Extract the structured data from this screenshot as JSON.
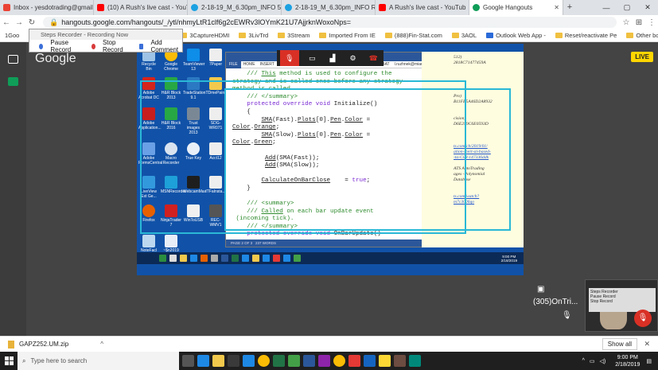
{
  "browser": {
    "tabs": [
      {
        "label": "Inbox - yesdotrading@gmail.",
        "color": "#ea4335"
      },
      {
        "label": "(10) A Rush's live cast - YouT",
        "color": "#ff0000"
      },
      {
        "label": "2-18-19_M_6.30pm_INFO 5%",
        "color": "#1ba1e2"
      },
      {
        "label": "2-18-19_M_6.30pm_INFO Re",
        "color": "#1ba1e2"
      },
      {
        "label": "A Rush's live cast - YouTub",
        "color": "#ff0000"
      },
      {
        "label": "Google Hangouts",
        "color": "#0f9d58"
      }
    ],
    "new_tab": "+",
    "url": "hangouts.google.com/hangouts/_/ytl/nhmyLtR1clf6g2cEWRv3lOYmK21U7AjjrknWoxoNps=",
    "bookmarks": [
      "1Goo",
      "Apps",
      "Google",
      "3CaptureHDMI",
      "3LivTrd",
      "3Stream",
      "Imported From IE",
      "(888)Fin-Stat.com",
      "3AOL",
      "Outlook Web App -",
      "Reset/reactivate Pe",
      "Other bookmarks"
    ]
  },
  "steps_recorder": {
    "title": "Steps Recorder - Recording Now",
    "pause": "Pause Record",
    "stop": "Stop Record",
    "add_comment": "Add Comment"
  },
  "hangouts": {
    "logo": "Google",
    "live_badge": "LIVE",
    "pip_label": "(305)OnTri...",
    "pip_tools": [
      "Steps Recorder",
      "Pause Record",
      "Stop Record"
    ]
  },
  "desktop_icons": [
    "Recycle Bin",
    "Google Chrome",
    "TeamViewer 13",
    "7Paper",
    "Adobe Acrobat DC",
    "H&R Block 2013",
    "TradeStation 9.1",
    "TDmePaint",
    "Adobe Application...",
    "H&R Block 2016",
    "Trust images 2013",
    "SDG-WR071",
    "Adobe FormsCentral",
    "Macro Recorder",
    "True Key",
    "Acct12",
    "LiveView Ext Ge...",
    "MSNRecorder",
    "WebcamMax",
    "ITFaInsta...",
    "Firefox",
    "NinjaTrader 7",
    "WinToUSB",
    "REC-WMV1",
    "NoteFacl",
    "~$n2019"
  ],
  "word": {
    "ribbon": [
      "FILE",
      "HOME",
      "INSERT",
      "ACROBAT"
    ],
    "user": "l.ruzhnek@miami.edu",
    "status_left": "PAGE 2 OF 3",
    "status_words": "237 WORDS",
    "zoom": "100%",
    "code_lines": [
      "    /// This method is used to configure the",
      "strategy and is called once before any strategy",
      "method is called.",
      "    /// </summary>",
      "    protected override void Initialize()",
      "    {",
      "        SMA(Fast).Plots[0].Pen.Color =",
      "Color.Orange;",
      "        SMA(Slow).Plots[0].Pen.Color =",
      "Color.Green;",
      "",
      "        Add(SMA(Fast));",
      "        Add(SMA(Slow));",
      "",
      "        CalculateOnBarClose    = true;",
      "    }",
      "",
      "    /// <summary>",
      "    /// Called on each bar update event",
      " (incoming tick).",
      "    /// </summary>",
      "    protected override void OnBarUpdate()"
    ]
  },
  "note_lines": [
    "512)",
    "2818C71477459A",
    "",
    "Pro)",
    "B11FE5A46D2A8932",
    "",
    "cision)",
    "D6E259C6E0593D",
    "",
    "ts.com/cb/2019/01/",
    "ation-their-ai-based-",
    "-ta-C08-147336ddk",
    "",
    "ATS AutoTrading",
    "ages -Polynomial",
    "Database",
    "",
    "",
    "ts.com/watch?",
    "m7c3006qo"
  ],
  "win_clock": {
    "time": "9:00 PM",
    "date": "2/18/2019"
  },
  "download": {
    "file": "GAPZ252.UM.zip",
    "show_all": "Show all"
  },
  "taskbar": {
    "search_placeholder": "Type here to search",
    "time": "9:00 PM",
    "date": "2/18/2019"
  }
}
